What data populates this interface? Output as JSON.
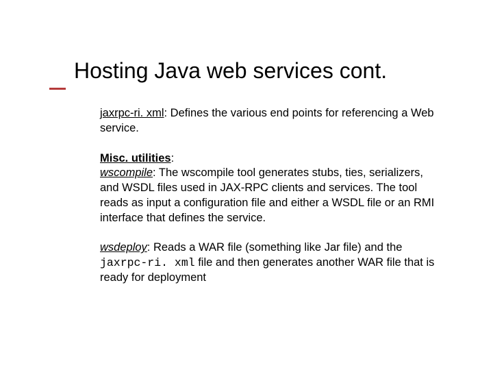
{
  "title": "Hosting Java web services cont.",
  "p1": {
    "term": "jaxrpc-ri. xml",
    "rest": ": Defines the various end points for referencing a Web service."
  },
  "subhead": "Misc. utilities",
  "colon": ":",
  "p2": {
    "term": "wscompile",
    "rest": ": The wscompile tool generates stubs, ties, serializers, and WSDL files used in JAX-RPC clients and services. The tool reads as input a configuration file and either a WSDL file or an RMI interface that defines the service."
  },
  "p3": {
    "term": "wsdeploy",
    "r1": ": Reads a WAR file (something like Jar file) and the ",
    "mono": "jaxrpc-ri. xml",
    "r2": "  file and then generates another WAR file that is ready for deployment"
  }
}
